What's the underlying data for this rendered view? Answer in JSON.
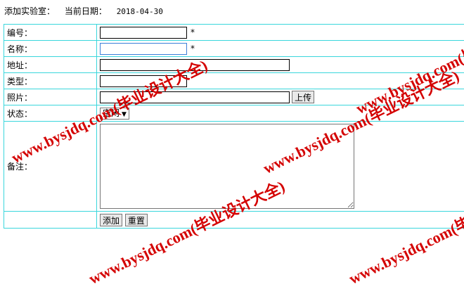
{
  "header": {
    "title": "添加实验室：",
    "date_label": "当前日期：",
    "date_value": "2018-04-30"
  },
  "form": {
    "fields": {
      "number": {
        "label": "编号：",
        "value": "",
        "required_mark": "*"
      },
      "name": {
        "label": "名称：",
        "value": "",
        "required_mark": "*"
      },
      "address": {
        "label": "地址：",
        "value": ""
      },
      "type": {
        "label": "类型：",
        "value": ""
      },
      "photo": {
        "label": "照片：",
        "value": "",
        "upload_label": "上传"
      },
      "status": {
        "label": "状态：",
        "selected": "空闲"
      },
      "notes": {
        "label": "备注：",
        "value": ""
      }
    },
    "buttons": {
      "add": "添加",
      "reset": "重置"
    }
  },
  "watermark": {
    "text": "www.bysjdq.com(毕业设计大全)",
    "color": "#d40000"
  },
  "colors": {
    "table_border": "#3ad6dc"
  },
  "icons": {
    "select_arrow": "chevron-down-icon"
  }
}
